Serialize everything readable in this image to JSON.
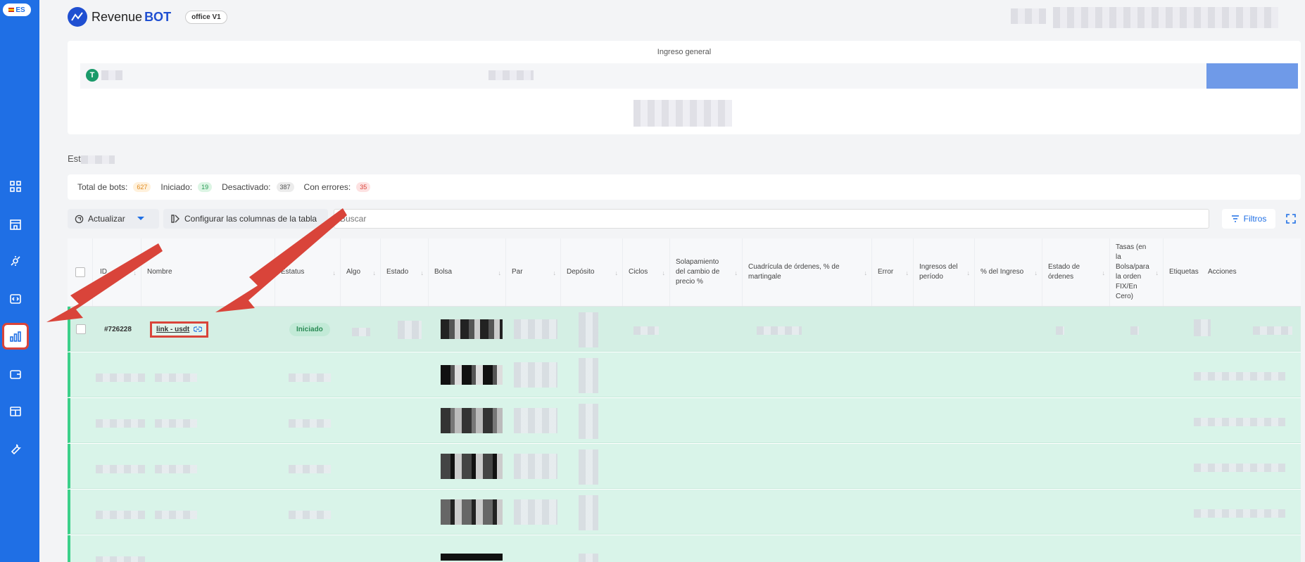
{
  "sidebar": {
    "language": "ES",
    "items": [
      {
        "icon": "dashboard-icon"
      },
      {
        "icon": "store-icon"
      },
      {
        "icon": "bot-settings-icon"
      },
      {
        "icon": "code-icon"
      },
      {
        "icon": "bar-chart-icon",
        "active": true
      },
      {
        "icon": "wallet-icon"
      },
      {
        "icon": "layout-icon"
      },
      {
        "icon": "wrench-icon"
      }
    ]
  },
  "header": {
    "brand_part1": "Revenue",
    "brand_part2": "BOT",
    "office_badge": "office V1"
  },
  "overview": {
    "title": "Ingreso general",
    "token_initial": "T"
  },
  "section_title": "Est",
  "stats": {
    "total_label": "Total de bots:",
    "total_value": "627",
    "started_label": "Iniciado:",
    "started_value": "19",
    "disabled_label": "Desactivado:",
    "disabled_value": "387",
    "errors_label": "Con errores:",
    "errors_value": "35"
  },
  "toolbar": {
    "refresh_label": "Actualizar",
    "configure_label": "Configurar las columnas de la tabla",
    "search_placeholder": "Buscar",
    "filters_label": "Filtros"
  },
  "table": {
    "columns": [
      "ID",
      "Nombre",
      "Estatus",
      "Algo",
      "Estado",
      "Bolsa",
      "Par",
      "Depósito",
      "Ciclos",
      "Solapamiento del cambio de precio %",
      "Cuadrícula de órdenes, % de martingale",
      "Error",
      "Ingresos del período",
      "% del Ingreso",
      "Estado de órdenes",
      "Tasas (en la Bolsa/para la orden FIX/En Cero)",
      "Etiquetas",
      "Acciones"
    ],
    "first_row": {
      "id": "#726228",
      "name": "link - usdt",
      "status": "Iniciado"
    }
  },
  "colors": {
    "sidebar": "#1f6fe5",
    "accent": "#1f4fd1",
    "row_green": "#d9f4e9",
    "annotation_red": "#d9443a"
  }
}
